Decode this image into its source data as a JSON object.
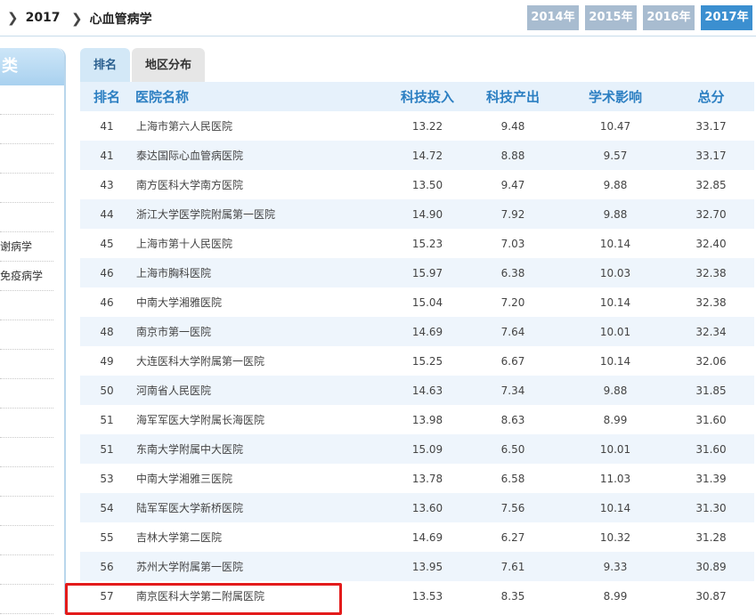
{
  "breadcrumb": {
    "year": "2017",
    "subject": "心血管病学"
  },
  "years": [
    "2014年",
    "2015年",
    "2016年",
    "2017年"
  ],
  "active_year": "2017年",
  "sidebar": {
    "head": "类",
    "items": [
      "",
      "",
      "",
      "",
      "",
      "谢病学",
      "免疫病学",
      "",
      "",
      "",
      "",
      "",
      "",
      "",
      "",
      "",
      "",
      ""
    ]
  },
  "tabs": [
    "排名",
    "地区分布"
  ],
  "table": {
    "headers": {
      "rank": "排名",
      "name": "医院名称",
      "invest": "科技投入",
      "output": "科技产出",
      "academic": "学术影响",
      "total": "总分"
    },
    "rows": [
      {
        "rank": "41",
        "name": "上海市第六人民医院",
        "invest": "13.22",
        "output": "9.48",
        "academic": "10.47",
        "total": "33.17"
      },
      {
        "rank": "41",
        "name": "泰达国际心血管病医院",
        "invest": "14.72",
        "output": "8.88",
        "academic": "9.57",
        "total": "33.17"
      },
      {
        "rank": "43",
        "name": "南方医科大学南方医院",
        "invest": "13.50",
        "output": "9.47",
        "academic": "9.88",
        "total": "32.85"
      },
      {
        "rank": "44",
        "name": "浙江大学医学院附属第一医院",
        "invest": "14.90",
        "output": "7.92",
        "academic": "9.88",
        "total": "32.70"
      },
      {
        "rank": "45",
        "name": "上海市第十人民医院",
        "invest": "15.23",
        "output": "7.03",
        "academic": "10.14",
        "total": "32.40"
      },
      {
        "rank": "46",
        "name": "上海市胸科医院",
        "invest": "15.97",
        "output": "6.38",
        "academic": "10.03",
        "total": "32.38"
      },
      {
        "rank": "46",
        "name": "中南大学湘雅医院",
        "invest": "15.04",
        "output": "7.20",
        "academic": "10.14",
        "total": "32.38"
      },
      {
        "rank": "48",
        "name": "南京市第一医院",
        "invest": "14.69",
        "output": "7.64",
        "academic": "10.01",
        "total": "32.34"
      },
      {
        "rank": "49",
        "name": "大连医科大学附属第一医院",
        "invest": "15.25",
        "output": "6.67",
        "academic": "10.14",
        "total": "32.06"
      },
      {
        "rank": "50",
        "name": "河南省人民医院",
        "invest": "14.63",
        "output": "7.34",
        "academic": "9.88",
        "total": "31.85"
      },
      {
        "rank": "51",
        "name": "海军军医大学附属长海医院",
        "invest": "13.98",
        "output": "8.63",
        "academic": "8.99",
        "total": "31.60"
      },
      {
        "rank": "51",
        "name": "东南大学附属中大医院",
        "invest": "15.09",
        "output": "6.50",
        "academic": "10.01",
        "total": "31.60"
      },
      {
        "rank": "53",
        "name": "中南大学湘雅三医院",
        "invest": "13.78",
        "output": "6.58",
        "academic": "11.03",
        "total": "31.39"
      },
      {
        "rank": "54",
        "name": "陆军军医大学新桥医院",
        "invest": "13.60",
        "output": "7.56",
        "academic": "10.14",
        "total": "31.30"
      },
      {
        "rank": "55",
        "name": "吉林大学第二医院",
        "invest": "14.69",
        "output": "6.27",
        "academic": "10.32",
        "total": "31.28"
      },
      {
        "rank": "56",
        "name": "苏州大学附属第一医院",
        "invest": "13.95",
        "output": "7.61",
        "academic": "9.33",
        "total": "30.89"
      },
      {
        "rank": "57",
        "name": "南京医科大学第二附属医院",
        "invest": "13.53",
        "output": "8.35",
        "academic": "8.99",
        "total": "30.87"
      }
    ]
  },
  "colors": {
    "accent": "#3b8fd0",
    "header_text": "#2c7fc2",
    "highlight": "#e31b1b"
  }
}
